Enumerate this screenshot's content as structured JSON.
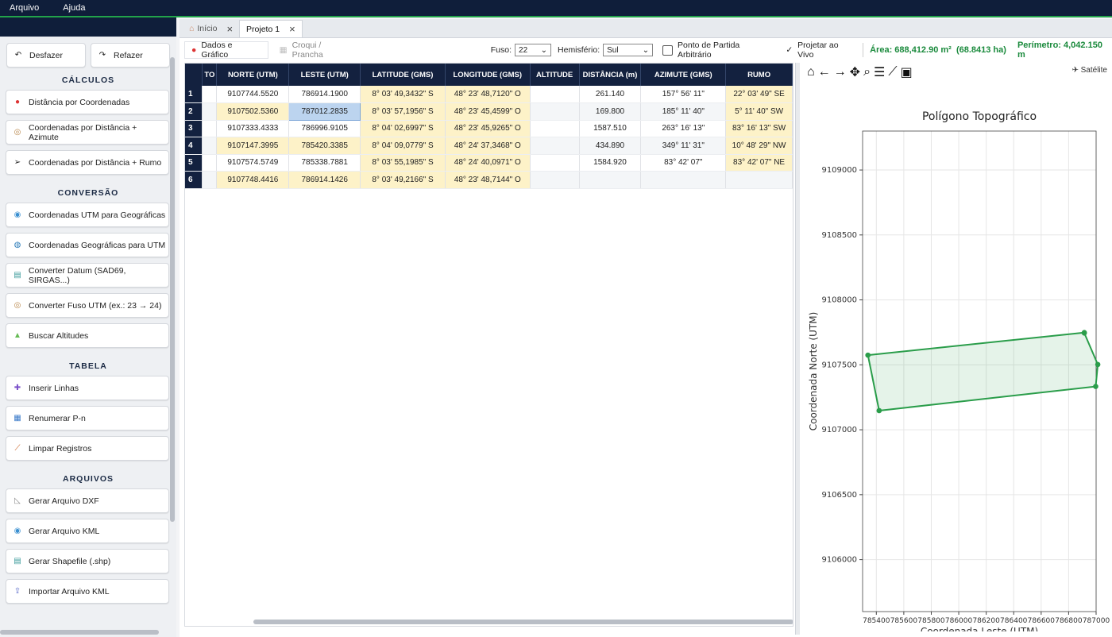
{
  "menu": [
    "Arquivo",
    "Ajuda"
  ],
  "sidebar": {
    "undo": "Desfazer",
    "redo": "Refazer",
    "sections": [
      {
        "title": "CÁLCULOS",
        "items": [
          {
            "label": "Distância por Coordenadas",
            "icon": "pin-icon"
          },
          {
            "label": "Coordenadas por Distância + Azimute",
            "icon": "compass-icon"
          },
          {
            "label": "Coordenadas por Distância + Rumo",
            "icon": "arrow-icon"
          }
        ]
      },
      {
        "title": "CONVERSÃO",
        "items": [
          {
            "label": "Coordenadas UTM para Geográficas",
            "icon": "globe-icon"
          },
          {
            "label": "Coordenadas Geográficas para UTM",
            "icon": "earth-icon"
          },
          {
            "label": "Converter Datum (SAD69, SIRGAS...)",
            "icon": "map-icon"
          },
          {
            "label": "Converter Fuso UTM (ex.: 23 → 24)",
            "icon": "compass-icon"
          },
          {
            "label": "Buscar Altitudes",
            "icon": "mountain-icon"
          }
        ]
      },
      {
        "title": "TABELA",
        "items": [
          {
            "label": "Inserir Linhas",
            "icon": "plus-icon"
          },
          {
            "label": "Renumerar P-n",
            "icon": "numbers-icon"
          },
          {
            "label": "Limpar Registros",
            "icon": "broom-icon"
          }
        ]
      },
      {
        "title": "ARQUIVOS",
        "items": [
          {
            "label": "Gerar Arquivo DXF",
            "icon": "ruler-icon"
          },
          {
            "label": "Gerar Arquivo KML",
            "icon": "globe-icon"
          },
          {
            "label": "Gerar Shapefile (.shp)",
            "icon": "map-icon"
          },
          {
            "label": "Importar Arquivo KML",
            "icon": "import-icon"
          }
        ]
      }
    ]
  },
  "tabs": [
    {
      "label": "Início",
      "active": false
    },
    {
      "label": "Projeto 1",
      "active": true
    }
  ],
  "toolbar": {
    "subtab_data": "Dados e Gráfico",
    "subtab_croqui": "Croqui / Prancha",
    "fuso_label": "Fuso:",
    "fuso_value": "22",
    "hemisferio_label": "Hemisfério:",
    "hemisferio_value": "Sul",
    "arbitrary_label": "Ponto de Partida Arbitrário",
    "live_label": "Projetar ao Vivo",
    "area": "Área: 688,412.90 m²  (68.8413 ha)",
    "perimetro": "Perímetro: 4,042.150 m"
  },
  "table": {
    "headers": [
      "TO",
      "NORTE (UTM)",
      "LESTE (UTM)",
      "LATITUDE (GMS)",
      "LONGITUDE (GMS)",
      "ALTITUDE",
      "DISTÂNCIA (m)",
      "AZIMUTE (GMS)",
      "RUMO"
    ],
    "rows": [
      {
        "n": "1",
        "norte": "9107744.5520",
        "leste": "786914.1900",
        "lat": "8° 03' 49,3432\" S",
        "lon": "48° 23' 48,7120\" O",
        "alt": "",
        "dist": "261.140",
        "az": "157° 56' 11\"",
        "rumo": "22° 03' 49\" SE"
      },
      {
        "n": "2",
        "norte": "9107502.5360",
        "leste": "787012.2835",
        "lat": "8° 03' 57,1956\" S",
        "lon": "48° 23' 45,4599\" O",
        "alt": "",
        "dist": "169.800",
        "az": "185° 11' 40\"",
        "rumo": "5° 11' 40\" SW"
      },
      {
        "n": "3",
        "norte": "9107333.4333",
        "leste": "786996.9105",
        "lat": "8° 04' 02,6997\" S",
        "lon": "48° 23' 45,9265\" O",
        "alt": "",
        "dist": "1587.510",
        "az": "263° 16' 13\"",
        "rumo": "83° 16' 13\" SW"
      },
      {
        "n": "4",
        "norte": "9107147.3995",
        "leste": "785420.3385",
        "lat": "8° 04' 09,0779\" S",
        "lon": "48° 24' 37,3468\" O",
        "alt": "",
        "dist": "434.890",
        "az": "349° 11' 31\"",
        "rumo": "10° 48' 29\" NW"
      },
      {
        "n": "5",
        "norte": "9107574.5749",
        "leste": "785338.7881",
        "lat": "8° 03' 55,1985\" S",
        "lon": "48° 24' 40,0971\" O",
        "alt": "",
        "dist": "1584.920",
        "az": "83° 42' 07\"",
        "rumo": "83° 42' 07\" NE"
      },
      {
        "n": "6",
        "norte": "9107748.4416",
        "leste": "786914.1426",
        "lat": "8° 03' 49,2166\" S",
        "lon": "48° 23' 48,7144\" O",
        "alt": "",
        "dist": "",
        "az": "",
        "rumo": ""
      }
    ]
  },
  "plot": {
    "satellite": "Satélite",
    "tools": [
      "home-icon",
      "back-icon",
      "forward-icon",
      "pan-icon",
      "zoom-icon",
      "configure-icon",
      "edit-curve-icon",
      "save-icon"
    ]
  },
  "chart_data": {
    "type": "line",
    "title": "Polígono Topográfico",
    "xlabel": "Coordenada Leste (UTM)",
    "ylabel": "Coordenada Norte (UTM)",
    "xlim": [
      785300,
      787000
    ],
    "ylim": [
      9105600,
      9109300
    ],
    "xticks": [
      785400,
      785600,
      785800,
      786000,
      786200,
      786400,
      786600,
      786800,
      787000
    ],
    "xtick_labels": [
      "785400",
      "785600",
      "785800",
      "786000",
      "786200",
      "786400",
      "786600",
      "786800",
      "787000"
    ],
    "yticks": [
      9106000,
      9106500,
      9107000,
      9107500,
      9108000,
      9108500,
      9109000
    ],
    "ytick_labels": [
      "9106000",
      "9106500",
      "9107000",
      "9107500",
      "9108000",
      "9108500",
      "9109000"
    ],
    "grid": true,
    "color": "#2a9d4a",
    "points": [
      {
        "x": 786914.19,
        "y": 9107744.552
      },
      {
        "x": 787012.2835,
        "y": 9107502.536
      },
      {
        "x": 786996.9105,
        "y": 9107333.4333
      },
      {
        "x": 785420.3385,
        "y": 9107147.3995
      },
      {
        "x": 785338.7881,
        "y": 9107574.5749
      },
      {
        "x": 786914.1426,
        "y": 9107748.4416
      }
    ]
  }
}
